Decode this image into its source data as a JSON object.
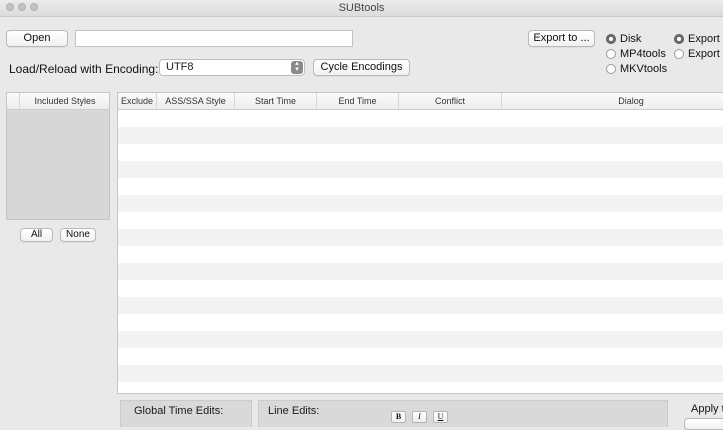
{
  "window": {
    "title": "SUBtools"
  },
  "toolbar": {
    "open_label": "Open",
    "file_path": "",
    "export_label": "Export to ...",
    "encoding_label": "Load/Reload with Encoding:",
    "encoding_value": "UTF8",
    "cycle_label": "Cycle Encodings"
  },
  "export_targets": [
    {
      "label": "Disk",
      "selected": true
    },
    {
      "label": "MP4tools",
      "selected": false
    },
    {
      "label": "MKVtools",
      "selected": false
    }
  ],
  "export_modes": [
    {
      "label": "Export a",
      "selected": true
    },
    {
      "label": "Export a",
      "selected": false
    }
  ],
  "styles_panel": {
    "header": "Included Styles",
    "all_label": "All",
    "none_label": "None"
  },
  "table": {
    "columns": [
      "Exclude",
      "ASS/SSA Style",
      "Start Time",
      "End Time",
      "Conflict",
      "Dialog"
    ],
    "rows": []
  },
  "bottom": {
    "global_time_edits": "Global Time Edits:",
    "line_edits": "Line Edits:",
    "bold": "B",
    "italic": "I",
    "underline": "U",
    "apply_label": "Apply t"
  }
}
